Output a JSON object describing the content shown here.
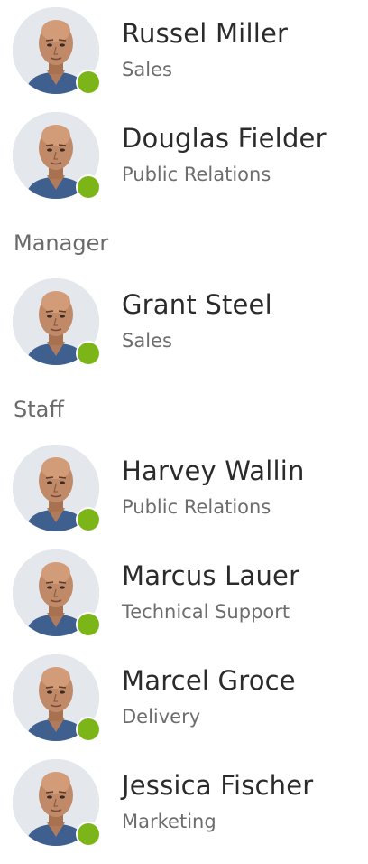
{
  "groups": [
    {
      "header": "",
      "contacts": [
        {
          "name": "Russel Miller",
          "department": "Sales",
          "online": true
        },
        {
          "name": "Douglas Fielder",
          "department": "Public Relations",
          "online": true
        }
      ]
    },
    {
      "header": "Manager",
      "contacts": [
        {
          "name": "Grant Steel",
          "department": "Sales",
          "online": true
        }
      ]
    },
    {
      "header": "Staff",
      "contacts": [
        {
          "name": "Harvey Wallin",
          "department": "Public Relations",
          "online": true
        },
        {
          "name": "Marcus Lauer",
          "department": "Technical Support",
          "online": true
        },
        {
          "name": "Marcel Groce",
          "department": "Delivery",
          "online": true
        },
        {
          "name": "Jessica Fischer",
          "department": "Marketing",
          "online": true
        }
      ]
    }
  ],
  "colors": {
    "presence_online": "#7cb518",
    "name_text": "#2b2b2b",
    "department_text": "#6d6d6d",
    "group_header_text": "#6a6a6a"
  },
  "icons": {
    "avatar": "person-photo-avatar",
    "presence": "online-status-dot"
  }
}
